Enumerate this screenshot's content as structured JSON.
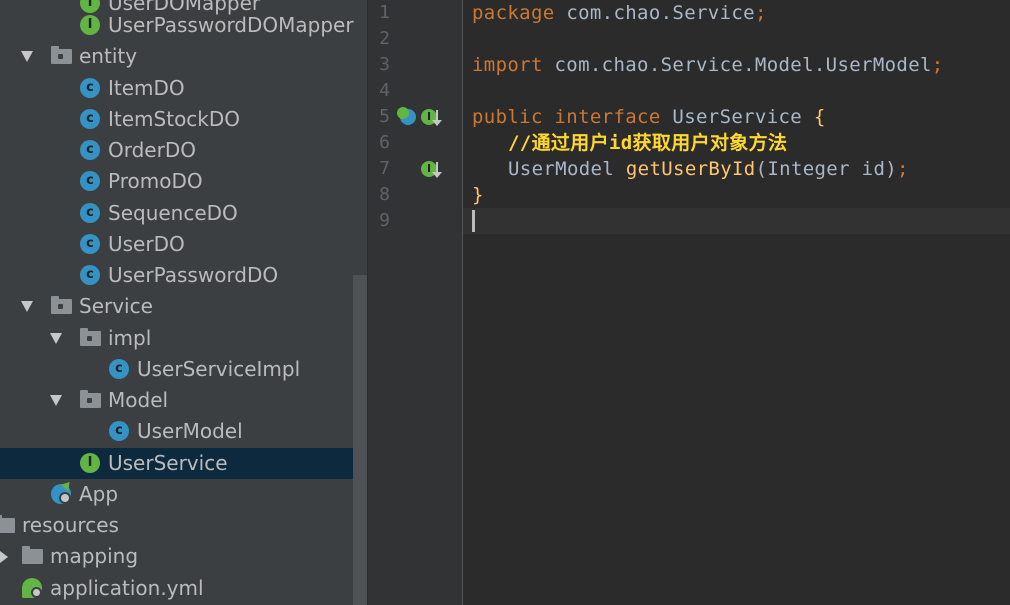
{
  "tree": {
    "items": [
      {
        "label": "UserDOMapper",
        "icon": "interface-icon"
      },
      {
        "label": "UserPasswordDOMapper",
        "icon": "interface-icon"
      },
      {
        "label": "entity",
        "icon": "package-folder-icon",
        "expanded": true
      },
      {
        "label": "ItemDO",
        "icon": "class-icon"
      },
      {
        "label": "ItemStockDO",
        "icon": "class-icon"
      },
      {
        "label": "OrderDO",
        "icon": "class-icon"
      },
      {
        "label": "PromoDO",
        "icon": "class-icon"
      },
      {
        "label": "SequenceDO",
        "icon": "class-icon"
      },
      {
        "label": "UserDO",
        "icon": "class-icon"
      },
      {
        "label": "UserPasswordDO",
        "icon": "class-icon"
      },
      {
        "label": "Service",
        "icon": "package-folder-icon",
        "expanded": true
      },
      {
        "label": "impl",
        "icon": "package-folder-icon",
        "expanded": true
      },
      {
        "label": "UserServiceImpl",
        "icon": "class-icon"
      },
      {
        "label": "Model",
        "icon": "package-folder-icon",
        "expanded": true
      },
      {
        "label": "UserModel",
        "icon": "class-icon"
      },
      {
        "label": "UserService",
        "icon": "interface-icon",
        "selected": true
      },
      {
        "label": "App",
        "icon": "spring-boot-app-icon"
      },
      {
        "label": "resources",
        "icon": "resources-folder-icon"
      },
      {
        "label": "mapping",
        "icon": "folder-icon",
        "expanded": false
      },
      {
        "label": "application.yml",
        "icon": "spring-config-icon"
      }
    ],
    "icon_letters": {
      "class": "c",
      "interface": "I"
    }
  },
  "editor": {
    "line_numbers": [
      "1",
      "2",
      "3",
      "4",
      "5",
      "6",
      "7",
      "8",
      "9"
    ],
    "code": {
      "l1_kw": "package",
      "l1_rest": " com.chao.Service",
      "l1_semi": ";",
      "l3_kw": "import",
      "l3_rest": " com.chao.Service.Model.UserModel",
      "l3_semi": ";",
      "l5_kw1": "public",
      "l5_kw2": " interface",
      "l5_name": " UserService ",
      "l5_brace": "{",
      "l6_comment": "//通过用户id获取用户对象方法",
      "l7_type": "UserModel ",
      "l7_fn": "getUserById",
      "l7_args": "(Integer id)",
      "l7_semi": ";",
      "l8_brace": "}"
    },
    "gutter_icons": [
      "implemented-by-icon",
      "interface-method-icon"
    ],
    "colors": {
      "keyword": "#cc7832",
      "function": "#ffc66d",
      "comment": "#ffd731",
      "text": "#a9b7c6"
    }
  }
}
